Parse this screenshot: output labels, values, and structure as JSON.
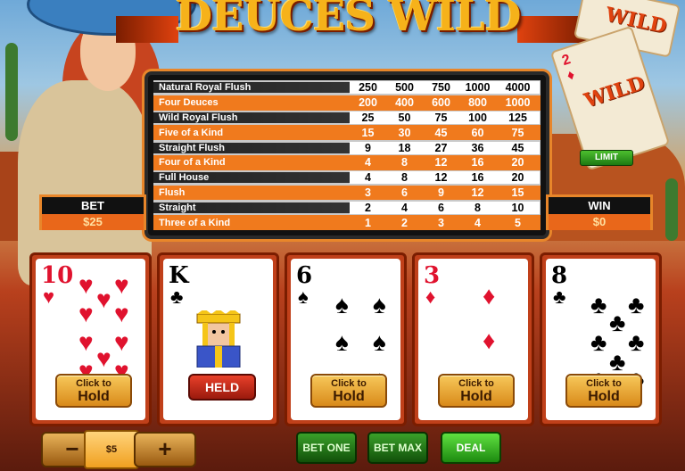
{
  "title": "DEUCES WILD",
  "paytable": [
    {
      "hand": "Natural Royal Flush",
      "pays": [
        "250",
        "500",
        "750",
        "1000",
        "4000"
      ]
    },
    {
      "hand": "Four Deuces",
      "pays": [
        "200",
        "400",
        "600",
        "800",
        "1000"
      ]
    },
    {
      "hand": "Wild Royal Flush",
      "pays": [
        "25",
        "50",
        "75",
        "100",
        "125"
      ]
    },
    {
      "hand": "Five of a Kind",
      "pays": [
        "15",
        "30",
        "45",
        "60",
        "75"
      ]
    },
    {
      "hand": "Straight Flush",
      "pays": [
        "9",
        "18",
        "27",
        "36",
        "45"
      ]
    },
    {
      "hand": "Four of a Kind",
      "pays": [
        "4",
        "8",
        "12",
        "16",
        "20"
      ]
    },
    {
      "hand": "Full House",
      "pays": [
        "4",
        "8",
        "12",
        "16",
        "20"
      ]
    },
    {
      "hand": "Flush",
      "pays": [
        "3",
        "6",
        "9",
        "12",
        "15"
      ]
    },
    {
      "hand": "Straight",
      "pays": [
        "2",
        "4",
        "6",
        "8",
        "10"
      ]
    },
    {
      "hand": "Three of a Kind",
      "pays": [
        "1",
        "2",
        "3",
        "4",
        "5"
      ]
    }
  ],
  "bet": {
    "label": "BET",
    "value": "$25"
  },
  "win": {
    "label": "WIN",
    "value": "$0"
  },
  "limit_label": "LIMIT",
  "wild_label": "WILD",
  "cards": [
    {
      "rank": "10",
      "suit": "♥",
      "color": "red",
      "hold_small": "Click to",
      "hold_big": "Hold",
      "held": false
    },
    {
      "rank": "K",
      "suit": "♣",
      "color": "black",
      "held_label": "HELD",
      "held": true
    },
    {
      "rank": "6",
      "suit": "♠",
      "color": "black",
      "hold_small": "Click to",
      "hold_big": "Hold",
      "held": false
    },
    {
      "rank": "3",
      "suit": "♦",
      "color": "red",
      "hold_small": "Click to",
      "hold_big": "Hold",
      "held": false
    },
    {
      "rank": "8",
      "suit": "♣",
      "color": "black",
      "hold_small": "Click to",
      "hold_big": "Hold",
      "held": false
    }
  ],
  "controls": {
    "minus": "−",
    "plus": "+",
    "coin_value": "$5",
    "bet_one": "BET ONE",
    "bet_max": "BET MAX",
    "deal": "DEAL"
  }
}
